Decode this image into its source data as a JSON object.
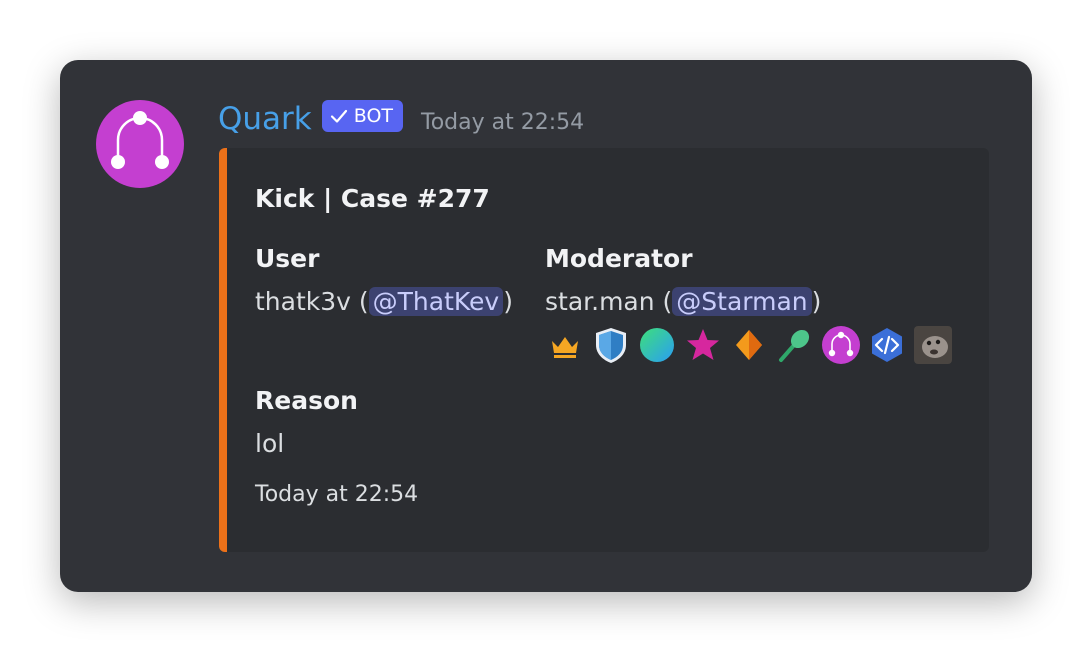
{
  "message": {
    "author": {
      "username": "Quark",
      "bot_tag": "BOT",
      "avatar_icon": "quark-logo-icon",
      "avatar_color": "#c43fd0"
    },
    "timestamp": "Today at 22:54"
  },
  "embed": {
    "accent_color": "#ec7119",
    "title": "Kick | Case #277",
    "fields": {
      "user": {
        "name": "User",
        "value_prefix": "thatk3v (",
        "mention": "@ThatKev",
        "value_suffix": ")"
      },
      "moderator": {
        "name": "Moderator",
        "value_prefix": "star.man (",
        "mention": "@Starman",
        "value_suffix": ")",
        "badges": [
          "crown-icon",
          "shield-icon",
          "gradient-circle-icon",
          "star-icon",
          "diamond-icon",
          "axe-icon",
          "quark-logo-icon",
          "code-icon",
          "avatar-photo-icon"
        ]
      },
      "reason": {
        "name": "Reason",
        "value": "lol"
      }
    },
    "footer": "Today at 22:54"
  }
}
